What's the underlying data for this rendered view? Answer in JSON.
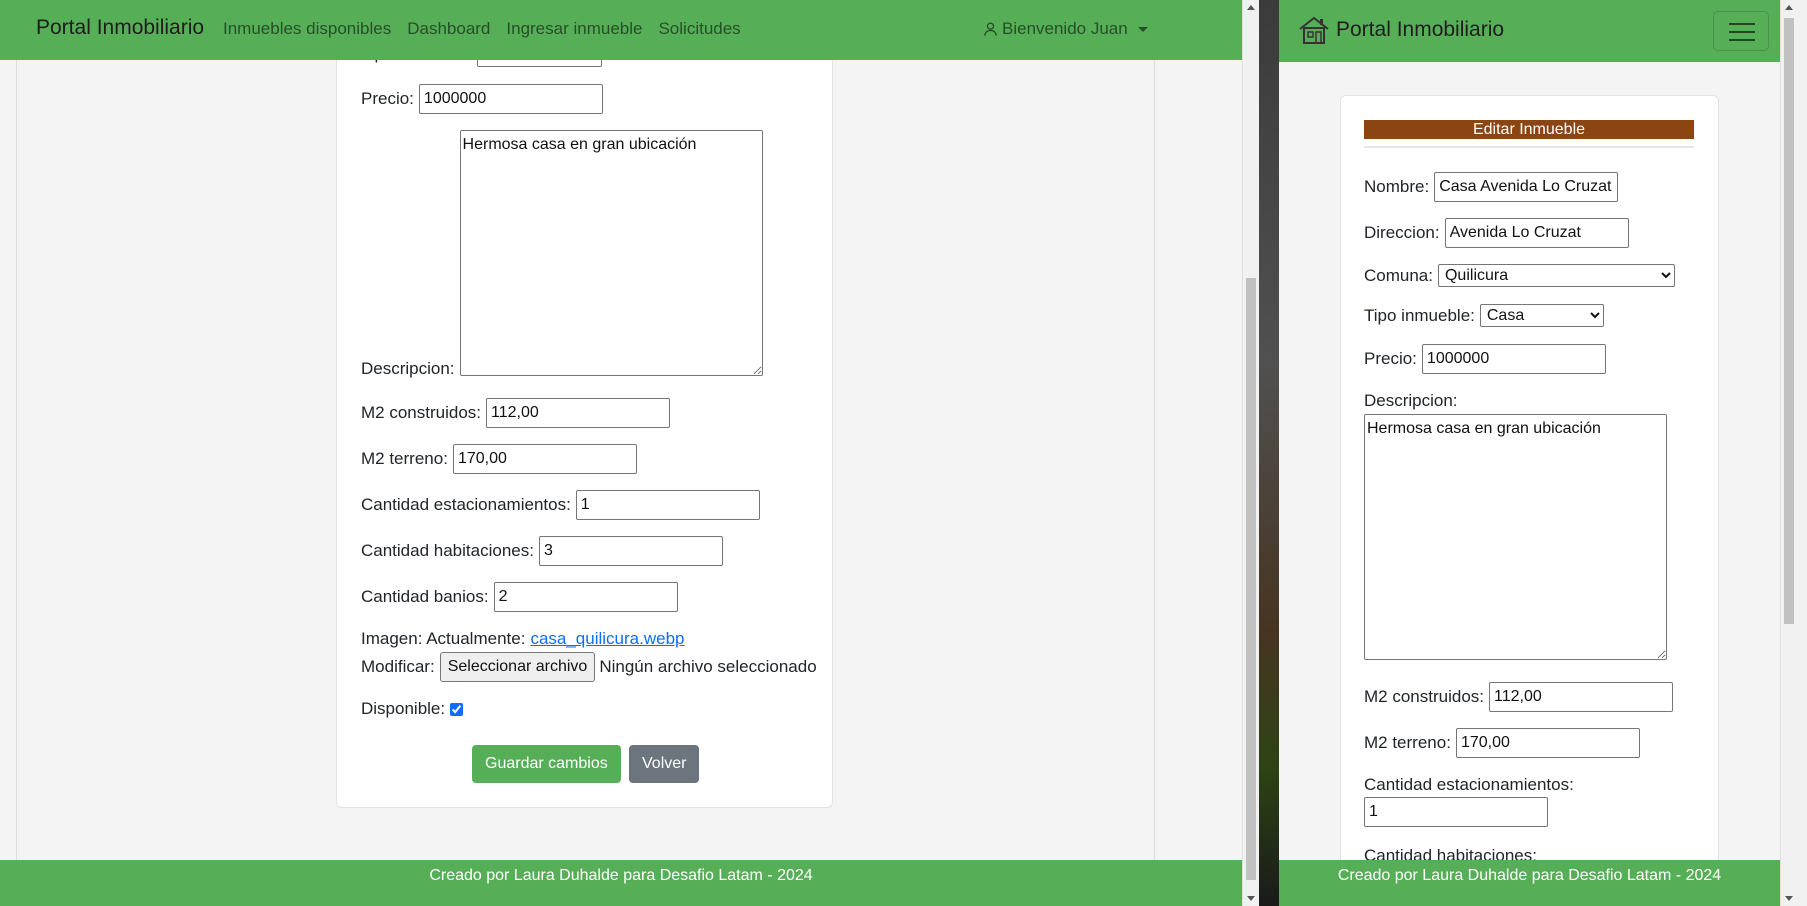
{
  "left": {
    "brand": "Portal Inmobiliario",
    "nav": [
      "Inmuebles disponibles",
      "Dashboard",
      "Ingresar inmueble",
      "Solicitudes"
    ],
    "user_menu": "Bienvenido Juan",
    "form": {
      "tipo_label": "Tipo inmueble:",
      "tipo_value": "Casa",
      "precio_label": "Precio:",
      "precio_value": "1000000",
      "descripcion_label": "Descripcion:",
      "descripcion_value": "Hermosa casa en gran ubicación",
      "m2c_label": "M2 construidos:",
      "m2c_value": "112,00",
      "m2t_label": "M2 terreno:",
      "m2t_value": "170,00",
      "est_label": "Cantidad estacionamientos:",
      "est_value": "1",
      "hab_label": "Cantidad habitaciones:",
      "hab_value": "3",
      "ban_label": "Cantidad banios:",
      "ban_value": "2",
      "imagen_label": "Imagen: Actualmente:",
      "imagen_link": "casa_quilicura.webp",
      "modificar_label": "Modificar:",
      "file_button": "Seleccionar archivo",
      "file_status": "Ningún archivo seleccionado",
      "disponible_label": "Disponible:",
      "disponible_checked": true,
      "save_button": "Guardar cambios",
      "back_button": "Volver"
    },
    "footer": "Creado por Laura Duhalde para Desafio Latam - 2024",
    "scroll_position": 0.75
  },
  "right": {
    "brand": "Portal Inmobiliario",
    "header": "Editar Inmueble",
    "form": {
      "nombre_label": "Nombre:",
      "nombre_value": "Casa Avenida Lo Cruzat I",
      "direccion_label": "Direccion:",
      "direccion_value": "Avenida Lo Cruzat",
      "comuna_label": "Comuna:",
      "comuna_value": "Quilicura",
      "tipo_label": "Tipo inmueble:",
      "tipo_value": "Casa",
      "precio_label": "Precio:",
      "precio_value": "1000000",
      "descripcion_label": "Descripcion:",
      "descripcion_value": "Hermosa casa en gran ubicación",
      "m2c_label": "M2 construidos:",
      "m2c_value": "112,00",
      "m2t_label": "M2 terreno:",
      "m2t_value": "170,00",
      "est_label": "Cantidad estacionamientos:",
      "est_value": "1",
      "hab_label": "Cantidad habitaciones:"
    },
    "footer": "Creado por Laura Duhalde para Desafio Latam - 2024",
    "scroll_position": 0.0
  },
  "colors": {
    "navbar": "#56ae57",
    "edit_header": "#8b4513",
    "link": "#0d6efd",
    "back_button": "#6c757d"
  }
}
